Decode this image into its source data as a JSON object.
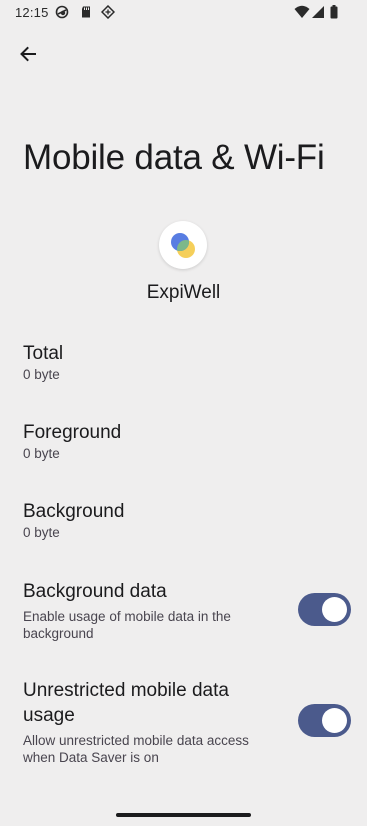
{
  "status_bar": {
    "time": "12:15",
    "icons": [
      "vpn-icon",
      "sd-card-icon",
      "data-saver-icon",
      "wifi-icon",
      "cell-signal-icon",
      "battery-icon"
    ]
  },
  "header": {
    "back_icon": "arrow-back-icon",
    "title": "Mobile data & Wi-Fi"
  },
  "app": {
    "name": "ExpiWell",
    "icon": "expiwell-logo-icon",
    "colors": {
      "blue": "#4a72e0",
      "yellow": "#f5cf5a",
      "green": "#7cb88a"
    }
  },
  "usage": [
    {
      "title": "Total",
      "value": "0 byte"
    },
    {
      "title": "Foreground",
      "value": "0 byte"
    },
    {
      "title": "Background",
      "value": "0 byte"
    }
  ],
  "settings": [
    {
      "title": "Background data",
      "description": "Enable usage of mobile data in the background",
      "enabled": true
    },
    {
      "title": "Unrestricted mobile data usage",
      "description": "Allow unrestricted mobile data access when Data Saver is on",
      "enabled": true
    }
  ],
  "colors": {
    "background": "#efeeee",
    "switch_on": "#4b5a8c"
  }
}
